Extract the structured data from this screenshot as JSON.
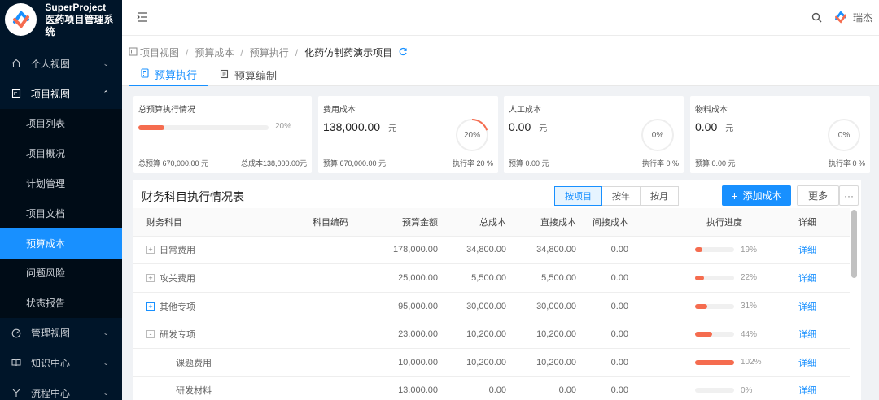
{
  "app": {
    "name": "SuperProject",
    "subtitle": "医药项目管理系统"
  },
  "sidebar": {
    "items": [
      {
        "label": "个人视图",
        "icon": "home-icon",
        "open": false
      },
      {
        "label": "项目视图",
        "icon": "project-icon",
        "open": true,
        "children": [
          {
            "label": "项目列表",
            "active": false
          },
          {
            "label": "项目概况",
            "active": false
          },
          {
            "label": "计划管理",
            "active": false
          },
          {
            "label": "项目文档",
            "active": false
          },
          {
            "label": "预算成本",
            "active": true
          },
          {
            "label": "问题风险",
            "active": false
          },
          {
            "label": "状态报告",
            "active": false
          }
        ]
      },
      {
        "label": "管理视图",
        "icon": "dashboard-icon",
        "open": false
      },
      {
        "label": "知识中心",
        "icon": "book-icon",
        "open": false
      },
      {
        "label": "流程中心",
        "icon": "flow-icon",
        "open": false
      }
    ]
  },
  "header": {
    "user_name": "瑞杰"
  },
  "breadcrumb": [
    "项目视图",
    "预算成本",
    "预算执行",
    "化药仿制药演示项目"
  ],
  "tabs": [
    {
      "label": "预算执行",
      "active": true
    },
    {
      "label": "预算编制",
      "active": false
    }
  ],
  "cards": {
    "total": {
      "title": "总预算执行情况",
      "percent_label": "20%",
      "percent": 20,
      "foot_left": "总预算 670,000.00 元",
      "foot_right": "总成本138,000.00元"
    },
    "fee": {
      "title": "费用成本",
      "amount": "138,000.00",
      "unit": "元",
      "percent_label": "20%",
      "percent": 20,
      "foot_left": "预算 670,000.00 元",
      "foot_right": "执行率 20 %"
    },
    "labor": {
      "title": "人工成本",
      "amount": "0.00",
      "unit": "元",
      "percent_label": "0%",
      "percent": 0,
      "foot_left": "预算 0.00 元",
      "foot_right": "执行率 0 %"
    },
    "material": {
      "title": "物料成本",
      "amount": "0.00",
      "unit": "元",
      "percent_label": "0%",
      "percent": 0,
      "foot_left": "预算 0.00 元",
      "foot_right": "执行率 0 %"
    }
  },
  "panel": {
    "title": "财务科目执行情况表",
    "seg": [
      "按项目",
      "按年",
      "按月"
    ],
    "add_label": "添加成本",
    "more_label": "更多",
    "dots_label": "···"
  },
  "table": {
    "headers": {
      "name": "财务科目",
      "code": "科目编码",
      "budget": "预算金额",
      "total": "总成本",
      "direct": "直接成本",
      "indirect": "间接成本",
      "progress": "执行进度",
      "detail": "详细"
    },
    "rows": [
      {
        "expander": "+",
        "name": "日常费用",
        "code": "",
        "budget": "178,000.00",
        "total": "34,800.00",
        "direct": "34,800.00",
        "indirect": "0.00",
        "progress": 19,
        "progress_label": "19%",
        "detail": "详细",
        "child": false,
        "highlight": false
      },
      {
        "expander": "+",
        "name": "攻关费用",
        "code": "",
        "budget": "25,000.00",
        "total": "5,500.00",
        "direct": "5,500.00",
        "indirect": "0.00",
        "progress": 22,
        "progress_label": "22%",
        "detail": "详细",
        "child": false,
        "highlight": false
      },
      {
        "expander": "+",
        "name": "其他专项",
        "code": "",
        "budget": "95,000.00",
        "total": "30,000.00",
        "direct": "30,000.00",
        "indirect": "0.00",
        "progress": 31,
        "progress_label": "31%",
        "detail": "详细",
        "child": false,
        "highlight": true
      },
      {
        "expander": "-",
        "name": "研发专项",
        "code": "",
        "budget": "23,000.00",
        "total": "10,200.00",
        "direct": "10,200.00",
        "indirect": "0.00",
        "progress": 44,
        "progress_label": "44%",
        "detail": "详细",
        "child": false,
        "highlight": false
      },
      {
        "expander": "",
        "name": "课题费用",
        "code": "",
        "budget": "10,000.00",
        "total": "10,200.00",
        "direct": "10,200.00",
        "indirect": "0.00",
        "progress": 100,
        "progress_label": "102%",
        "detail": "详细",
        "child": true,
        "highlight": false
      },
      {
        "expander": "",
        "name": "研发材料",
        "code": "",
        "budget": "13,000.00",
        "total": "0.00",
        "direct": "0.00",
        "indirect": "0.00",
        "progress": 0,
        "progress_label": "0%",
        "detail": "详细",
        "child": true,
        "highlight": false
      }
    ]
  },
  "colors": {
    "sidebar_bg": "#001529",
    "primary": "#1890ff",
    "progress": "#f56c4f"
  }
}
